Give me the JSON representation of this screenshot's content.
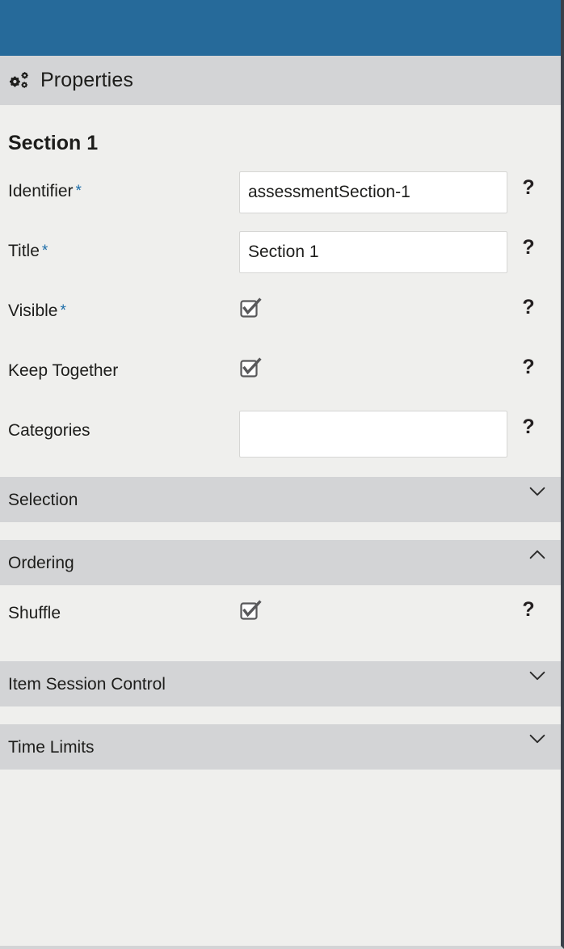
{
  "theme": {
    "topbar_color": "#266a9a",
    "panel_header_bg": "#d3d4d6",
    "body_bg": "#efefed",
    "required_star_color": "#1b6ca8",
    "text_color": "#1d1d1b",
    "input_bg": "#ffffff",
    "edge_color": "#3b4049"
  },
  "panel": {
    "icon": "cogs-icon",
    "title": "Properties"
  },
  "section": {
    "title": "Section 1"
  },
  "fields": [
    {
      "label": "Identifier",
      "required": true,
      "required_marker": "*",
      "type": "text",
      "value": "assessmentSection-1",
      "placeholder": "",
      "help": "?"
    },
    {
      "label": "Title",
      "required": true,
      "required_marker": "*",
      "type": "text",
      "value": "Section 1",
      "placeholder": "",
      "help": "?"
    },
    {
      "label": "Visible",
      "required": true,
      "required_marker": "*",
      "type": "checkbox",
      "checked": true,
      "help": "?"
    },
    {
      "label": "Keep Together",
      "required": false,
      "required_marker": "",
      "type": "checkbox",
      "checked": true,
      "help": "?"
    },
    {
      "label": "Categories",
      "required": false,
      "required_marker": "",
      "type": "text",
      "value": "",
      "placeholder": "",
      "help": "?"
    }
  ],
  "accordions": [
    {
      "title": "Selection",
      "expanded": false,
      "chevron": "chevron-down-icon",
      "fields": []
    },
    {
      "title": "Ordering",
      "expanded": true,
      "chevron": "chevron-up-icon",
      "fields": [
        {
          "label": "Shuffle",
          "required": false,
          "required_marker": "",
          "type": "checkbox",
          "checked": true,
          "help": "?"
        }
      ]
    },
    {
      "title": "Item Session Control",
      "expanded": false,
      "chevron": "chevron-down-icon",
      "fields": []
    },
    {
      "title": "Time Limits",
      "expanded": false,
      "chevron": "chevron-down-icon",
      "fields": []
    }
  ]
}
